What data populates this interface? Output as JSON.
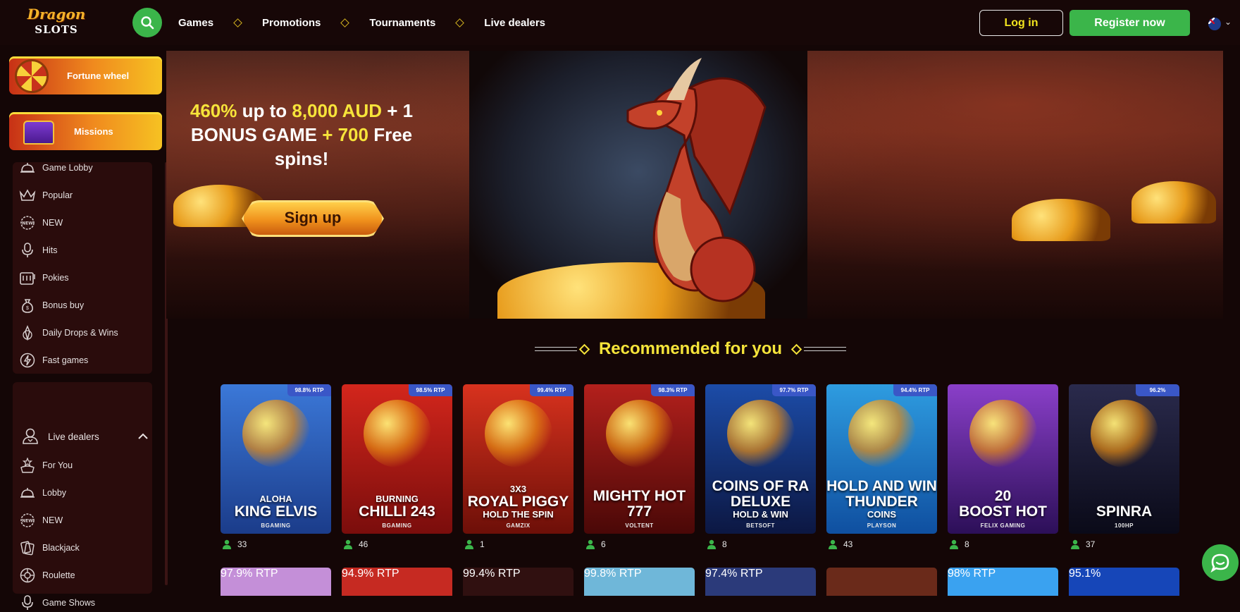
{
  "header": {
    "logo_top": "Dragon",
    "logo_bottom": "SLOTS",
    "nav": [
      "Games",
      "Promotions",
      "Tournaments",
      "Live dealers"
    ],
    "login_label": "Log in",
    "register_label": "Register now",
    "language": "AU"
  },
  "sidebar": {
    "promos": [
      {
        "label": "Fortune wheel",
        "icon": "fortune-wheel-icon"
      },
      {
        "label": "Missions",
        "icon": "treasure-chest-icon"
      }
    ],
    "games_menu": [
      {
        "label": "Game Lobby",
        "icon": "bell-icon"
      },
      {
        "label": "Popular",
        "icon": "crown-icon"
      },
      {
        "label": "NEW",
        "icon": "new-badge-icon"
      },
      {
        "label": "Hits",
        "icon": "microphone-icon"
      },
      {
        "label": "Pokies",
        "icon": "slot-machine-icon"
      },
      {
        "label": "Bonus buy",
        "icon": "money-bag-icon"
      },
      {
        "label": "Daily Drops & Wins",
        "icon": "drops-wins-icon"
      },
      {
        "label": "Fast games",
        "icon": "lightning-icon"
      }
    ],
    "live_dealers": {
      "title": "Live dealers",
      "icon": "dealer-icon",
      "expanded": true,
      "items": [
        {
          "label": "For You",
          "icon": "star-hand-icon"
        },
        {
          "label": "Lobby",
          "icon": "bell-icon"
        },
        {
          "label": "NEW",
          "icon": "new-badge-icon"
        },
        {
          "label": "Blackjack",
          "icon": "cards-icon"
        },
        {
          "label": "Roulette",
          "icon": "roulette-icon"
        },
        {
          "label": "Game Shows",
          "icon": "microphone-icon"
        }
      ]
    }
  },
  "hero": {
    "line1_a": "460%",
    "line1_b": " up to ",
    "line1_c": "8,000 AUD",
    "line1_d": " + 1",
    "line2_a": "BONUS GAME",
    "line2_b": " + 700",
    "line2_c": " Free",
    "line3": "spins!",
    "cta": "Sign up"
  },
  "recommended": {
    "title": "Recommended for you",
    "games": [
      {
        "line1": "ALOHA",
        "line2": "KING ELVIS",
        "line3": "",
        "provider": "BGAMING",
        "rtp": "98.8% RTP",
        "players": "33",
        "bg1": "#3b78d8",
        "bg2": "#1b3c8a"
      },
      {
        "line1": "BURNING",
        "line2": "CHILLI 243",
        "line3": "",
        "provider": "BGAMING",
        "rtp": "98.5% RTP",
        "players": "46",
        "bg1": "#d3261c",
        "bg2": "#7a0d0c"
      },
      {
        "line1": "3X3",
        "line2": "ROYAL PIGGY",
        "line3": "HOLD THE SPIN",
        "provider": "GAMZIX",
        "rtp": "99.4% RTP",
        "players": "1",
        "bg1": "#d8321e",
        "bg2": "#6d0f08"
      },
      {
        "line1": "MIGHTY HOT",
        "line2": "777",
        "line3": "",
        "provider": "VOLTENT",
        "rtp": "98.3% RTP",
        "players": "6",
        "bg1": "#b3201c",
        "bg2": "#4a0807"
      },
      {
        "line1": "COINS OF RA",
        "line2": "DELUXE",
        "line3": "HOLD & WIN",
        "provider": "BETSOFT",
        "rtp": "97.7% RTP",
        "players": "8",
        "bg1": "#1c4ca8",
        "bg2": "#0c1742"
      },
      {
        "line1": "HOLD AND WIN",
        "line2": "THUNDER",
        "line3": "COINS",
        "provider": "PLAYSON",
        "rtp": "94.4% RTP",
        "players": "43",
        "bg1": "#2e9ce0",
        "bg2": "#0f4fa0"
      },
      {
        "line1": "20",
        "line2": "BOOST HOT",
        "line3": "",
        "provider": "FELIX GAMING",
        "rtp": "",
        "players": "8",
        "bg1": "#8a3fc9",
        "bg2": "#2c0f58"
      },
      {
        "line1": "",
        "line2": "SPINRA",
        "line3": "",
        "provider": "100HP",
        "rtp": "96.2%",
        "players": "37",
        "bg1": "#2a2a4c",
        "bg2": "#0a0a18"
      }
    ],
    "row2_rtp": [
      "97.9% RTP",
      "94.9% RTP",
      "99.4% RTP",
      "99.8% RTP",
      "97.4% RTP",
      "",
      "98% RTP",
      "95.1%"
    ],
    "row2_bg": [
      "#c48fd8",
      "#c62a22",
      "#301010",
      "#6fb7d9",
      "#2b3a7a",
      "#6a2a1a",
      "#3aa2f0",
      "#1646b8"
    ]
  },
  "chat_icon": "chat-bubble-icon"
}
